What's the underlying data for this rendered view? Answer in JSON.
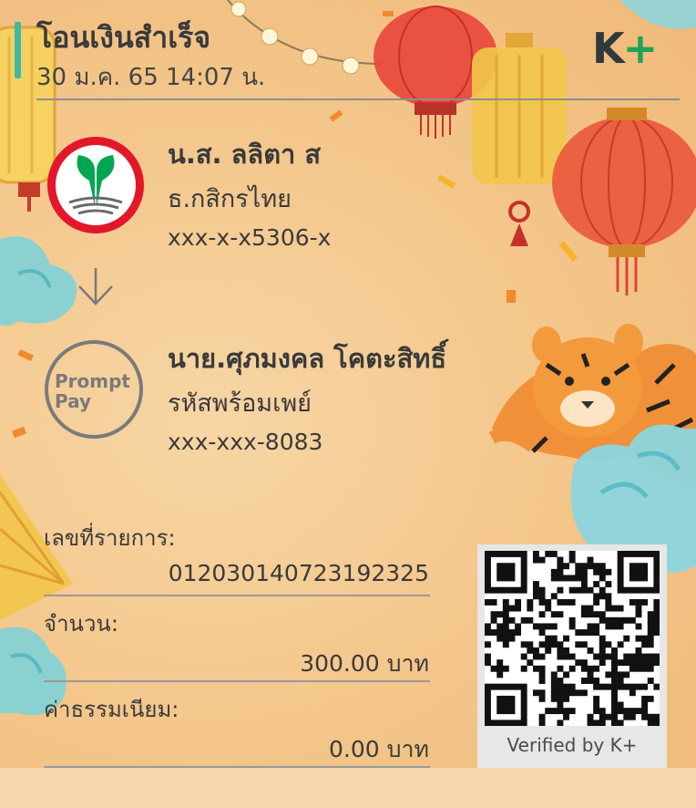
{
  "header": {
    "title": "โอนเงินสำเร็จ",
    "datetime": "30 ม.ค. 65  14:07 น.",
    "brand_logo_k": "K",
    "brand_logo_plus": "+"
  },
  "sender": {
    "name": "น.ส. ลลิตา ส",
    "bank": "ธ.กสิกรไทย",
    "account": "xxx-x-x5306-x",
    "logo_icon": "kasikornbank-logo-icon"
  },
  "receiver": {
    "name": "นาย.ศุภมงคล โคตะสิทธิ์",
    "type": "รหัสพร้อมเพย์",
    "account": "xxx-xxx-8083",
    "logo_line1": "Prompt",
    "logo_line2": "Pay"
  },
  "details": {
    "ref_label": "เลขที่รายการ:",
    "ref_value": "012030140723192325",
    "amount_label": "จำนวน:",
    "amount_value": "300.00 บาท",
    "fee_label": "ค่าธรรมเนียม:",
    "fee_value": "0.00 บาท"
  },
  "qr": {
    "caption": "Verified by K+"
  },
  "colors": {
    "accent": "#3fb9a4",
    "brand_green": "#1fa35a",
    "bank_red": "#e3172a",
    "bank_green": "#00a651",
    "background": "#f4c88e"
  }
}
